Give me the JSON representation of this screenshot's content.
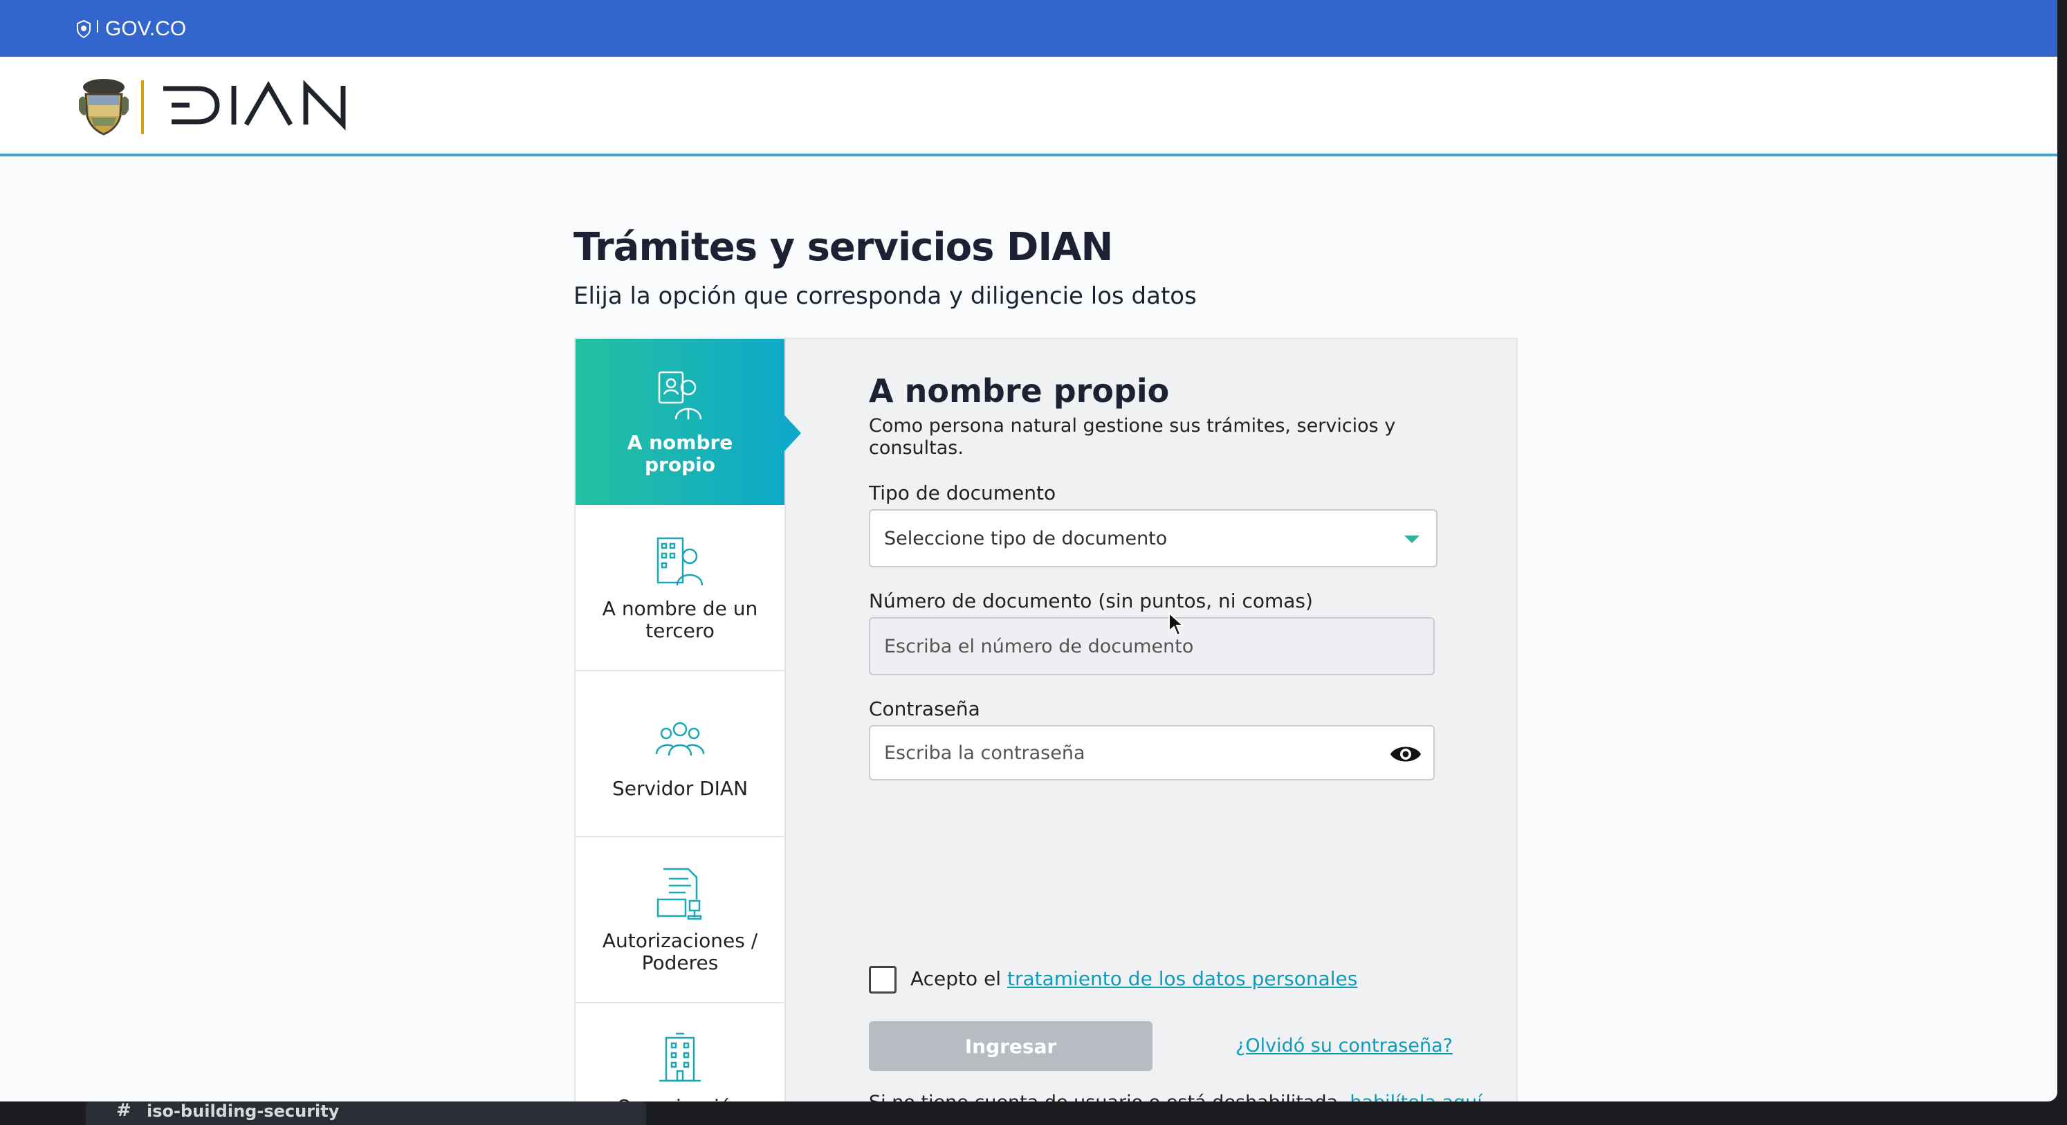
{
  "gov_bar": {
    "label": "GOV.CO",
    "color": "#3366cc"
  },
  "header": {
    "brand": "DIAN"
  },
  "page": {
    "title": "Trámites y servicios DIAN",
    "subtitle": "Elija la opción que corresponda y diligencie los datos"
  },
  "menu": {
    "items": [
      {
        "label": "A nombre propio",
        "icon": "person-id-card-icon",
        "active": true
      },
      {
        "label": "A nombre de un tercero",
        "icon": "person-building-icon",
        "active": false
      },
      {
        "label": "Servidor DIAN",
        "icon": "team-people-icon",
        "active": false
      },
      {
        "label": "Autorizaciones / Poderes",
        "icon": "document-stamp-icon",
        "active": false
      },
      {
        "label": "Organización",
        "icon": "office-building-icon",
        "active": false
      }
    ]
  },
  "form": {
    "title": "A nombre propio",
    "description": "Como persona natural gestione sus trámites, servicios y consultas.",
    "doc_type": {
      "label": "Tipo de documento",
      "value": "Seleccione tipo de documento"
    },
    "doc_number": {
      "label": "Número de documento (sin puntos, ni comas)",
      "placeholder": "Escriba el número de documento"
    },
    "password": {
      "label": "Contraseña",
      "placeholder": "Escriba la contraseña",
      "icon": "eye-icon"
    },
    "accept": {
      "prefix": "Acepto el",
      "link": "tratamiento de los datos personales",
      "checked": false
    },
    "submit_label": "Ingresar",
    "forgot_link": "¿Olvidó su contraseña?",
    "no_account": {
      "prefix": "Si no tiene cuenta de usuario o está deshabilitada,",
      "link": "habilítela aquí"
    }
  },
  "taskbar": {
    "channel": "iso-building-security"
  },
  "colors": {
    "accent": "#0e9bb8",
    "teal": "#25c0a0",
    "button_disabled": "#b7bcc3"
  }
}
